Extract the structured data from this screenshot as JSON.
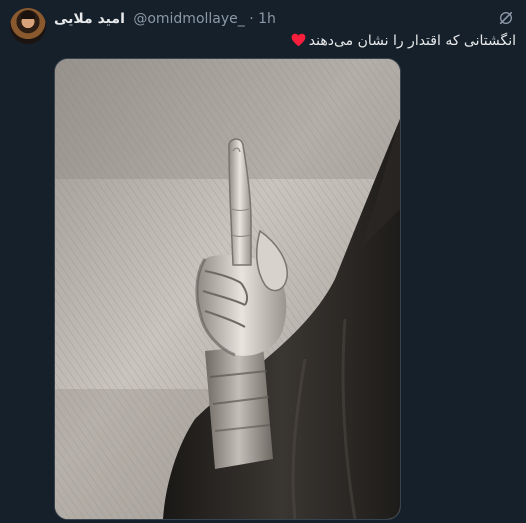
{
  "tweet": {
    "display_name": "امید ملایی",
    "handle": "@omidmollaye_",
    "separator": "·",
    "time": "1h",
    "text": "انگشتانی که اقتدار را نشان می‌دهند",
    "media": {
      "kind": "pencil-drawing",
      "alt_subject": "raised-index-finger-hand-sleeve"
    },
    "icons": {
      "avatar": "avatar",
      "grok": "grok-icon",
      "emoji": "heart-icon"
    }
  },
  "colors": {
    "background": "#15202b",
    "text_primary": "#e7e9ea",
    "text_secondary": "#8b98a5",
    "heart": "#f91f3c",
    "media_border": "#38444d"
  }
}
